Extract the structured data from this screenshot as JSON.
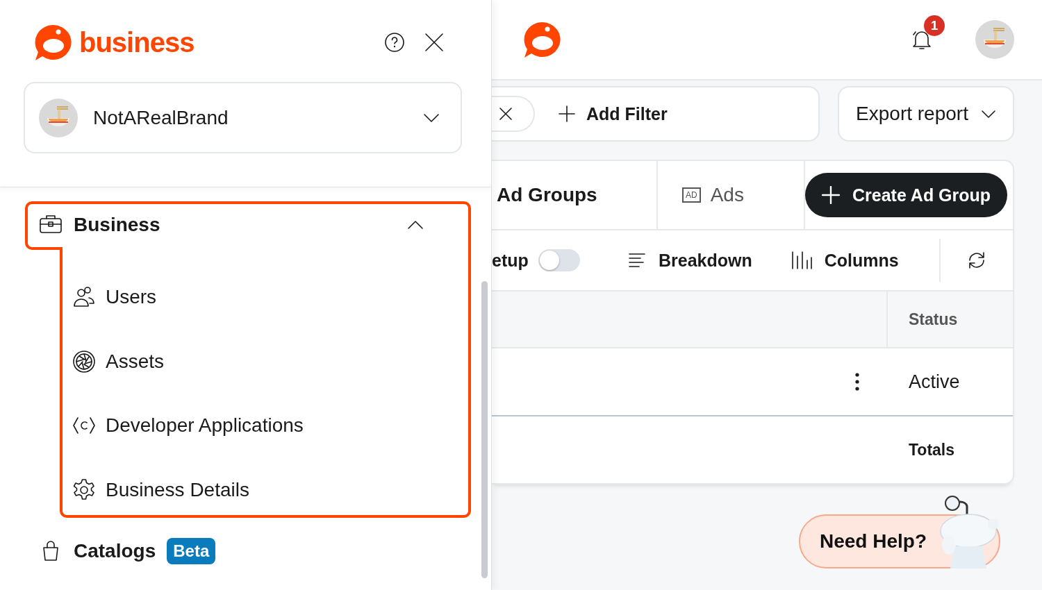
{
  "drawer": {
    "logo_text": "business",
    "account": {
      "name": "NotARealBrand"
    },
    "nav": [
      {
        "label": "Business",
        "expanded": true,
        "children": [
          {
            "label": "Users"
          },
          {
            "label": "Assets"
          },
          {
            "label": "Developer Applications"
          },
          {
            "label": "Business Details"
          }
        ]
      },
      {
        "label": "Catalogs",
        "badge": "Beta"
      }
    ]
  },
  "top_bar": {
    "notification_count": "1"
  },
  "filter_bar": {
    "add_filter": "Add Filter",
    "export_button": "Export report"
  },
  "tabs": [
    {
      "label": "Ad Groups",
      "selected": true
    },
    {
      "label": "Ads",
      "selected": false,
      "icon_text": "AD"
    }
  ],
  "create_button": "Create Ad Group",
  "toolbar": {
    "toggle": {
      "label": "etup",
      "on": false
    },
    "breakdown": "Breakdown",
    "columns": "Columns"
  },
  "table": {
    "columns": [
      "Status"
    ],
    "rows": [
      {
        "status": "Active"
      }
    ],
    "totals_label": "Totals"
  },
  "help_button": "Need Help?"
}
